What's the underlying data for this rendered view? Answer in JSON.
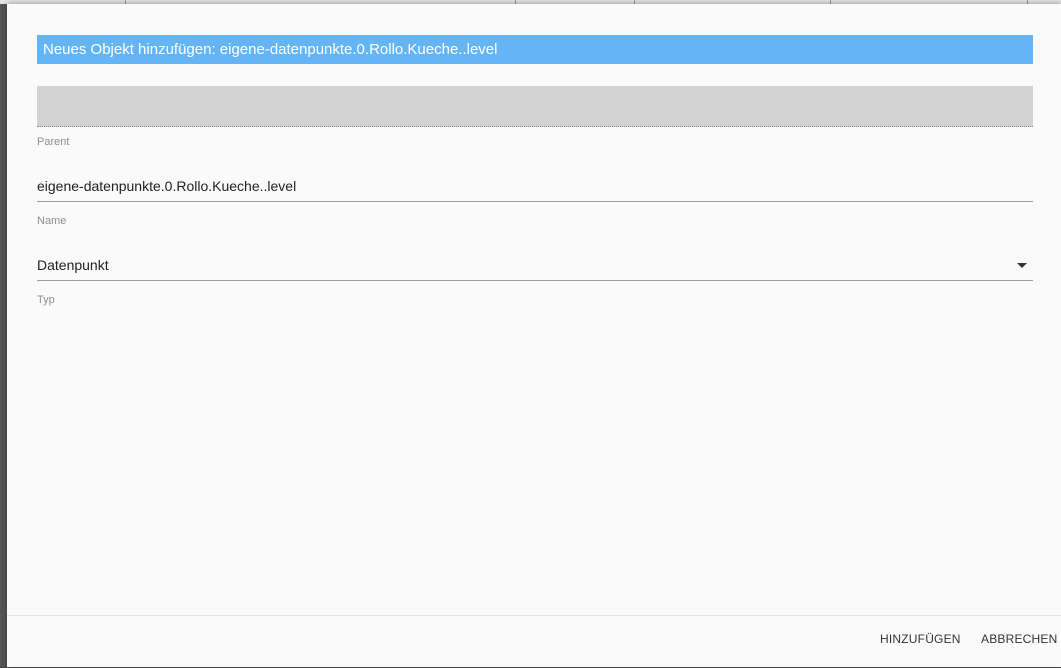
{
  "dialog": {
    "title": "Neues Objekt hinzufügen: eigene-datenpunkte.0.Rollo.Kueche..level"
  },
  "form": {
    "parent": {
      "value": "",
      "caption": "Parent"
    },
    "name": {
      "value": "eigene-datenpunkte.0.Rollo.Kueche..level",
      "caption": "Name"
    },
    "type": {
      "selected": "Datenpunkt",
      "caption": "Typ"
    }
  },
  "footer": {
    "add_label": "HINZUFÜGEN",
    "cancel_label": "ABBRECHEN"
  },
  "colors": {
    "title_bar": "#64b5f6",
    "dialog_bg": "#fafafa",
    "parent_field_bg": "#d3d3d3"
  },
  "icons": {
    "type_dropdown": "caret-down-icon"
  }
}
